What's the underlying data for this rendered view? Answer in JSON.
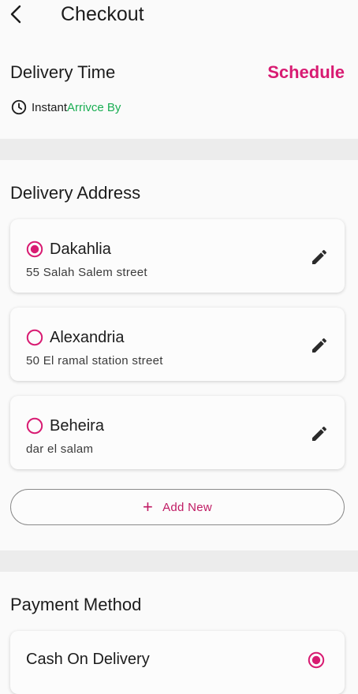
{
  "header": {
    "title": "Checkout",
    "back_icon": "arrow-back-icon"
  },
  "delivery_time": {
    "heading": "Delivery Time",
    "schedule_label": "Schedule",
    "instant_label": "Instant",
    "arrive_label": "Arrivce By"
  },
  "delivery_address": {
    "heading": "Delivery Address",
    "addresses": [
      {
        "name": "Dakahlia",
        "street": "55 Salah Salem street",
        "selected": true
      },
      {
        "name": "Alexandria",
        "street": "50 El ramal station street",
        "selected": false
      },
      {
        "name": "Beheira",
        "street": "dar el salam",
        "selected": false
      }
    ],
    "add_new_label": "Add New"
  },
  "payment": {
    "heading": "Payment Method",
    "option_label": "Cash On Delivery",
    "option_selected": true
  },
  "colors": {
    "accent": "#d81b72",
    "green": "#1aae53",
    "band": "#ececec"
  }
}
